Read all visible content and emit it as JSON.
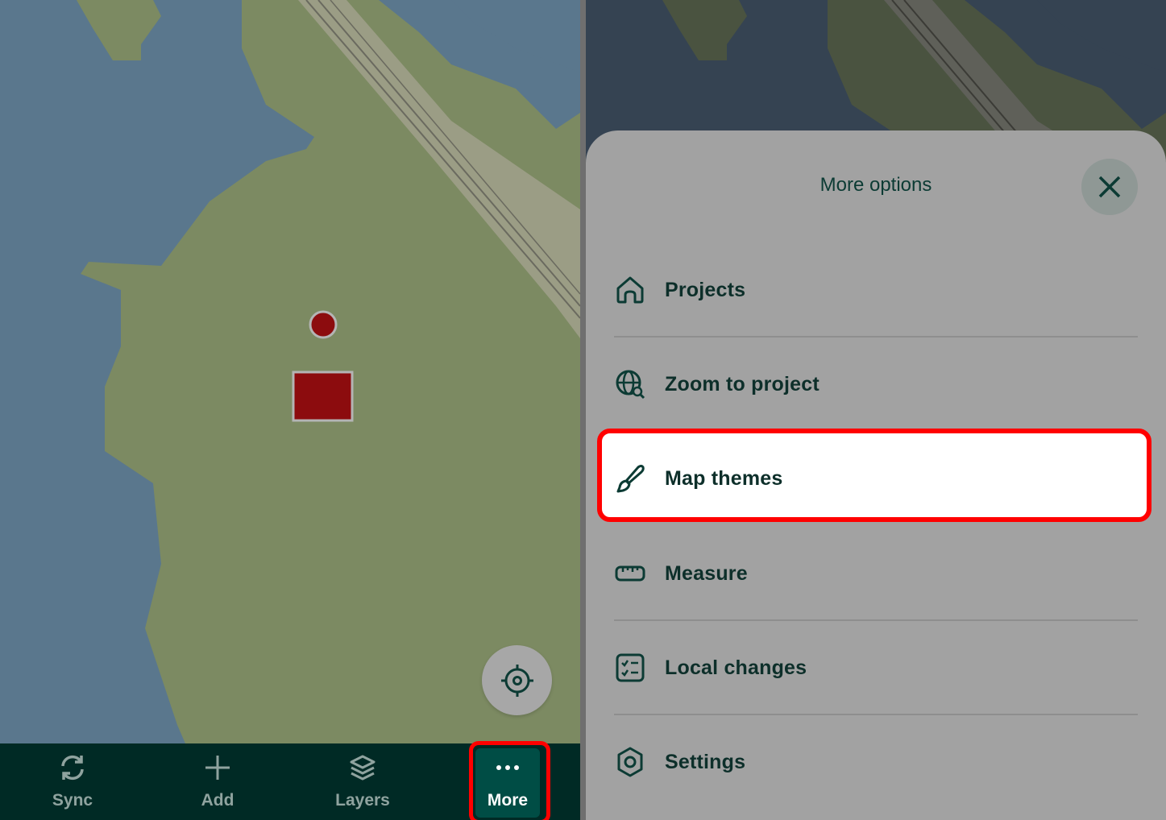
{
  "left_screen": {
    "bottom_nav": {
      "sync_label": "Sync",
      "add_label": "Add",
      "layers_label": "Layers",
      "more_label": "More"
    }
  },
  "right_screen": {
    "sheet": {
      "title": "More options",
      "items": [
        {
          "label": "Projects",
          "icon": "home-icon"
        },
        {
          "label": "Zoom to project",
          "icon": "globe-search-icon"
        },
        {
          "label": "Map themes",
          "icon": "brush-icon"
        },
        {
          "label": "Measure",
          "icon": "ruler-icon"
        },
        {
          "label": "Local changes",
          "icon": "checklist-icon"
        },
        {
          "label": "Settings",
          "icon": "settings-icon"
        }
      ]
    }
  },
  "colors": {
    "water": "#5a778d",
    "land": "#7c8a62",
    "road": "#a1a08c",
    "nav_bg": "#002a25",
    "nav_active": "#004d45",
    "highlight": "#ff0000",
    "feature": "#8c0c0e"
  }
}
